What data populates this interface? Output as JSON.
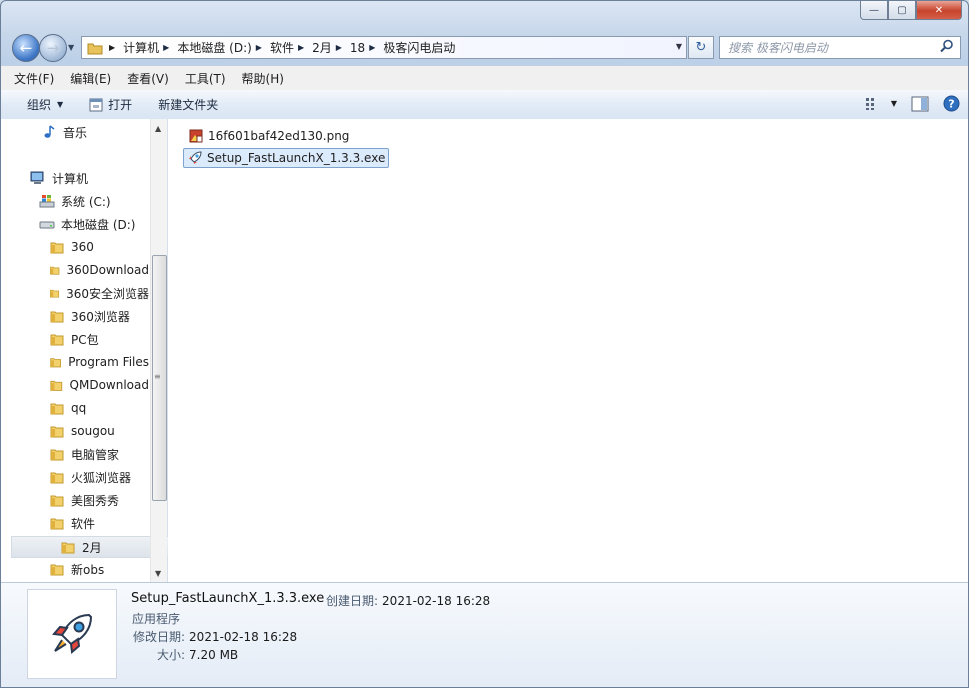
{
  "window": {
    "caption_min": "—",
    "caption_max": "▢",
    "caption_close": "✕"
  },
  "address": {
    "crumbs": [
      "计算机",
      "本地磁盘 (D:)",
      "软件",
      "2月",
      "18",
      "极客闪电启动"
    ]
  },
  "search": {
    "placeholder": "搜索 极客闪电启动"
  },
  "menu": [
    "文件(F)",
    "编辑(E)",
    "查看(V)",
    "工具(T)",
    "帮助(H)"
  ],
  "toolbar": {
    "organize": "组织",
    "open": "打开",
    "new_folder": "新建文件夹"
  },
  "nav_tree": [
    {
      "label": "音乐",
      "icon": "music-icon"
    },
    {
      "label": "计算机",
      "icon": "computer-icon"
    },
    {
      "label": "系统 (C:)",
      "icon": "system-drive-icon"
    },
    {
      "label": "本地磁盘 (D:)",
      "icon": "drive-icon"
    },
    {
      "label": "360",
      "icon": "folder-icon"
    },
    {
      "label": "360Download",
      "icon": "folder-icon"
    },
    {
      "label": "360安全浏览器",
      "icon": "folder-icon"
    },
    {
      "label": "360浏览器",
      "icon": "folder-icon"
    },
    {
      "label": "PC包",
      "icon": "folder-icon"
    },
    {
      "label": "Program Files",
      "icon": "folder-icon"
    },
    {
      "label": "QMDownload",
      "icon": "folder-icon"
    },
    {
      "label": "qq",
      "icon": "folder-icon"
    },
    {
      "label": "sougou",
      "icon": "folder-icon"
    },
    {
      "label": "电脑管家",
      "icon": "folder-icon"
    },
    {
      "label": "火狐浏览器",
      "icon": "folder-icon"
    },
    {
      "label": "美图秀秀",
      "icon": "folder-icon"
    },
    {
      "label": "软件",
      "icon": "folder-icon"
    },
    {
      "label": "2月",
      "icon": "folder-icon",
      "selected": true
    },
    {
      "label": "新obs",
      "icon": "folder-icon"
    }
  ],
  "files": [
    {
      "name": "16f601baf42ed130.png",
      "icon": "image-file-icon"
    },
    {
      "name": "Setup_FastLaunchX_1.3.3.exe",
      "icon": "rocket-icon",
      "selected": true
    }
  ],
  "details": {
    "name": "Setup_FastLaunchX_1.3.3.exe",
    "created_label": "创建日期:",
    "created_value": "2021-02-18 16:28",
    "type": "应用程序",
    "modified_label": "修改日期:",
    "modified_value": "2021-02-18 16:28",
    "size_label": "大小:",
    "size_value": "7.20 MB"
  },
  "colors": {
    "selection_bg": "#dcebfc",
    "selection_border": "#7da2ce",
    "close_button": "#c7432b",
    "folder": "#e8c25a"
  }
}
